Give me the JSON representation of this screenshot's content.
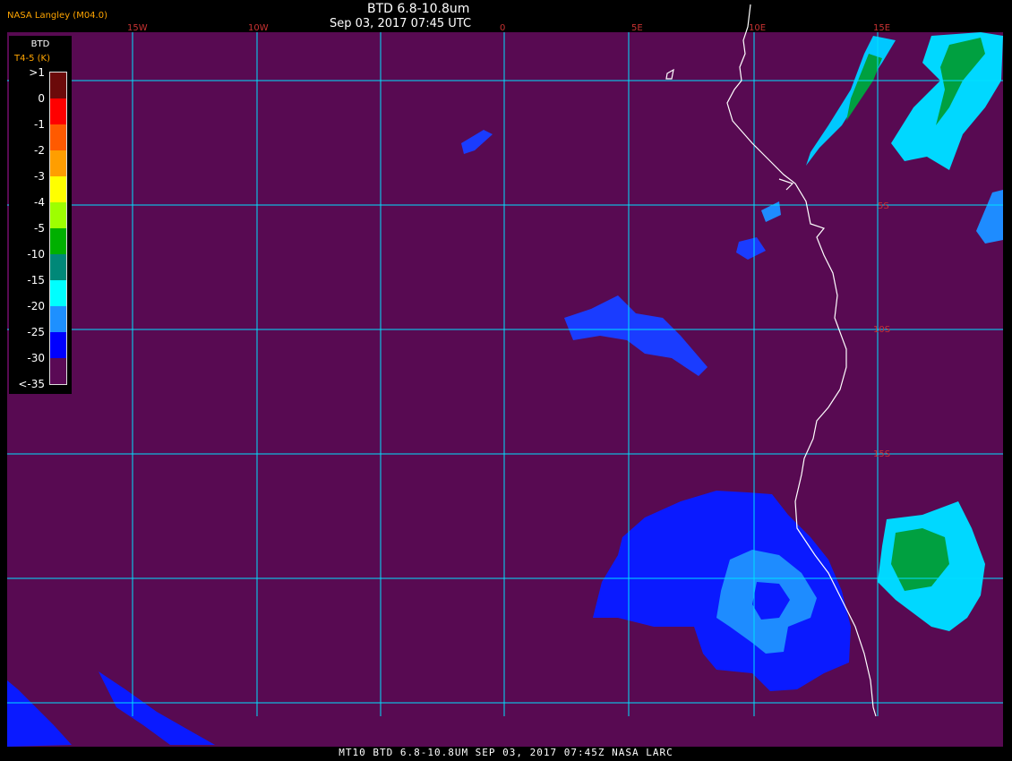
{
  "header": {
    "source": "NASA Langley (M04.0)",
    "title": "BTD 6.8-10.8um",
    "timestamp": "Sep 03, 2017 07:45 UTC"
  },
  "footer": {
    "text": "MT10  BTD 6.8-10.8UM  SEP 03, 2017 07:45Z  NASA LARC"
  },
  "legend": {
    "title": "BTD",
    "subtitle": "T4-5 (K)",
    "labels": [
      ">1",
      "0",
      "-1",
      "-2",
      "-3",
      "-4",
      "-5",
      "-10",
      "-15",
      "-20",
      "-25",
      "-30",
      "<-35"
    ],
    "colors": [
      "#6b0a0a",
      "#ff0000",
      "#ff5a00",
      "#ff9e00",
      "#ffff00",
      "#9eff00",
      "#00b000",
      "#008878",
      "#00ffff",
      "#1e90ff",
      "#0000ff",
      "#5a0a55"
    ]
  },
  "map": {
    "background": "#580a52",
    "gridline_color": "#00e0ff",
    "coast_color": "#ffffff",
    "label_color": "#c83232",
    "longitudes": [
      "15W",
      "10W",
      "0",
      "5E",
      "10E",
      "15E"
    ],
    "latitudes": [
      "5S",
      "10S",
      "15S"
    ]
  }
}
